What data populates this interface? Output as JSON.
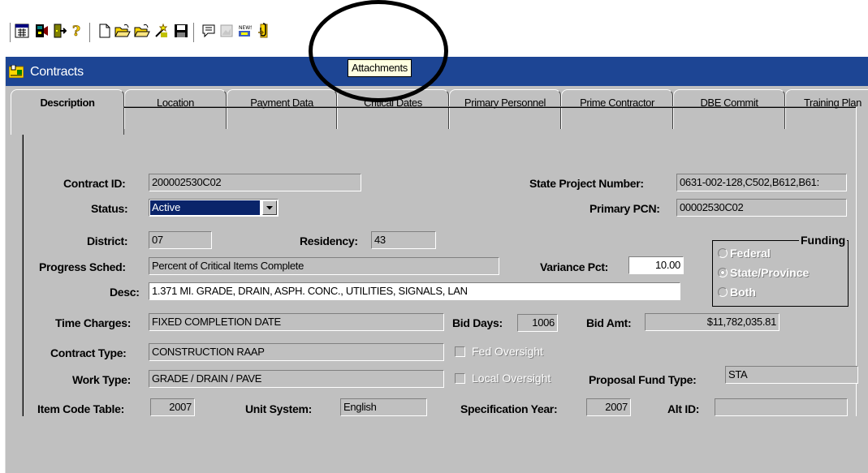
{
  "toolbar": {
    "buttons": [
      "list-view-icon",
      "services-icon",
      "exit-icon",
      "help-icon",
      "new-document-icon",
      "open-folder-icon",
      "open-folder-alt-icon",
      "wizard-icon",
      "save-icon",
      "comment-icon",
      "image-icon",
      "news-icon",
      "attachments-icon"
    ],
    "tooltip": "Attachments"
  },
  "window": {
    "title": "Contracts"
  },
  "tabs": [
    {
      "label": "Description",
      "active": true
    },
    {
      "label": "Location"
    },
    {
      "label": "Payment Data"
    },
    {
      "label": "Critical Dates"
    },
    {
      "label": "Primary Personnel"
    },
    {
      "label": "Prime Contractor"
    },
    {
      "label": "DBE Commit"
    },
    {
      "label": "Training Plan"
    }
  ],
  "form": {
    "contract_id": {
      "label": "Contract ID:",
      "value": "200002530C02"
    },
    "state_project_number": {
      "label": "State Project Number:",
      "value": "0631-002-128,C502,B612,B61:"
    },
    "status": {
      "label": "Status:",
      "value": "Active"
    },
    "primary_pcn": {
      "label": "Primary PCN:",
      "value": "00002530C02"
    },
    "district": {
      "label": "District:",
      "value": "07"
    },
    "residency": {
      "label": "Residency:",
      "value": "43"
    },
    "funding": {
      "title": "Funding",
      "options": [
        "Federal",
        "State/Province",
        "Both"
      ],
      "selected": "State/Province"
    },
    "progress_sched": {
      "label": "Progress Sched:",
      "value": "Percent of Critical Items Complete"
    },
    "variance_pct": {
      "label": "Variance Pct:",
      "value": "10.00"
    },
    "desc": {
      "label": "Desc:",
      "value": "1.371 MI. GRADE, DRAIN, ASPH. CONC., UTILITIES, SIGNALS, LAN"
    },
    "time_charges": {
      "label": "Time Charges:",
      "value": "FIXED COMPLETION DATE"
    },
    "bid_days": {
      "label": "Bid Days:",
      "value": "1006"
    },
    "bid_amt": {
      "label": "Bid Amt:",
      "value": "$11,782,035.81"
    },
    "contract_type": {
      "label": "Contract Type:",
      "value": "CONSTRUCTION RAAP"
    },
    "fed_oversight": {
      "label": "Fed Oversight"
    },
    "work_type": {
      "label": "Work Type:",
      "value": "GRADE / DRAIN / PAVE"
    },
    "local_oversight": {
      "label": "Local Oversight"
    },
    "proposal_fund_type": {
      "label": "Proposal Fund Type:",
      "value": "STA"
    },
    "item_code_table": {
      "label": "Item Code Table:",
      "value": "2007"
    },
    "unit_system": {
      "label": "Unit System:",
      "value": "English"
    },
    "specification_year": {
      "label": "Specification Year:",
      "value": "2007"
    },
    "alt_id": {
      "label": "Alt ID:",
      "value": ""
    }
  },
  "colors": {
    "window_bg": "#c0c0c0",
    "titlebar": "#1d4594",
    "selection": "#0a246a",
    "tooltip_bg": "#ffffe1"
  }
}
